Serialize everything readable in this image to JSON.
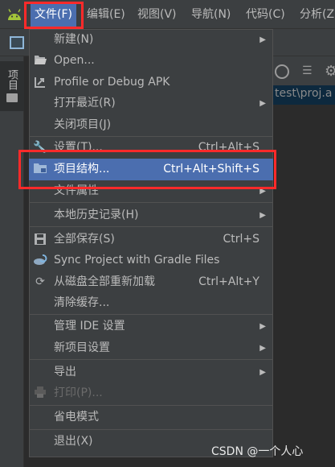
{
  "menubar": {
    "items": [
      {
        "label": "文件(F)"
      },
      {
        "label": "编辑(E)"
      },
      {
        "label": "视图(V)"
      },
      {
        "label": "导航(N)"
      },
      {
        "label": "代码(C)"
      },
      {
        "label": "分析(Z)"
      }
    ],
    "active_index": 0
  },
  "project_panel": {
    "tab_label": "项目",
    "path_text": "test\\proj.a"
  },
  "file_menu": {
    "new": {
      "label": "新建(N)"
    },
    "open": {
      "label": "Open...",
      "icon": "folder-open-icon"
    },
    "profile_debug": {
      "label": "Profile or Debug APK",
      "icon": "profile-apk-icon"
    },
    "open_recent": {
      "label": "打开最近(R)"
    },
    "close_project": {
      "label": "关闭项目(J)"
    },
    "settings": {
      "label": "设置(T)...",
      "shortcut": "Ctrl+Alt+S",
      "icon": "wrench-icon"
    },
    "project_structure": {
      "label": "项目结构...",
      "shortcut": "Ctrl+Alt+Shift+S",
      "icon": "project-structure-icon"
    },
    "file_properties": {
      "label": "文件属性"
    },
    "local_history": {
      "label": "本地历史记录(H)"
    },
    "save_all": {
      "label": "全部保存(S)",
      "shortcut": "Ctrl+S",
      "icon": "save-icon"
    },
    "sync_gradle": {
      "label": "Sync Project with Gradle Files",
      "icon": "gradle-sync-icon"
    },
    "reload_disk": {
      "label": "从磁盘全部重新加载",
      "shortcut": "Ctrl+Alt+Y",
      "icon": "reload-icon"
    },
    "invalidate_caches": {
      "label": "清除缓存..."
    },
    "manage_ide_settings": {
      "label": "管理 IDE 设置"
    },
    "new_project_settings": {
      "label": "新项目设置"
    },
    "export": {
      "label": "导出"
    },
    "print": {
      "label": "打印(P)...",
      "icon": "printer-icon"
    },
    "power_save": {
      "label": "省电模式"
    },
    "exit": {
      "label": "退出(X)"
    }
  },
  "watermark": {
    "text": "CSDN @一个人心"
  },
  "colors": {
    "menu_bg": "#3c3f41",
    "selection": "#4b6eaf",
    "highlight_border": "#ff2a2a",
    "android_green": "#a4c639"
  }
}
